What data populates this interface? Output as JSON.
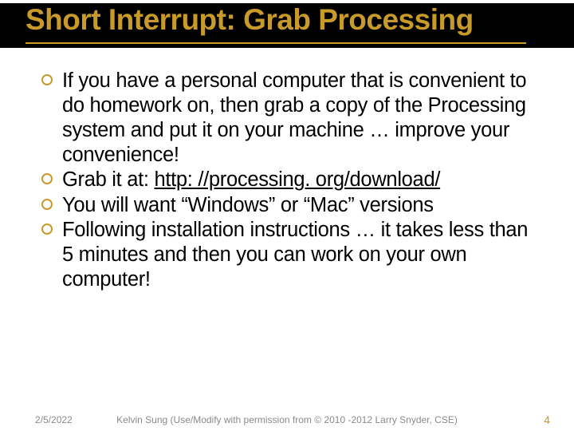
{
  "title": "Short Interrupt: Grab Processing",
  "bullets": {
    "b1": "If you have a personal computer that is convenient to do homework on, then grab a copy of the Processing system and put it on your machine … improve your convenience!",
    "b2_prefix": "Grab it at: ",
    "b2_link": "http: //processing. org/download/",
    "b3": "You will want “Windows” or “Mac” versions",
    "b4": "Following installation instructions … it takes less than 5 minutes and then you can work on your own computer!"
  },
  "footer": {
    "date": "2/5/2022",
    "credit": "Kelvin Sung (Use/Modify with permission from © 2010 -2012 Larry Snyder, CSE)",
    "page": "4"
  }
}
